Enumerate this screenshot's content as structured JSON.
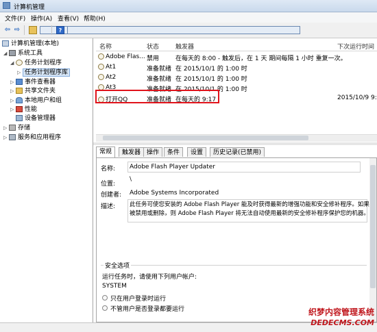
{
  "window": {
    "title": "计算机管理"
  },
  "menu": [
    "文件(F)",
    "操作(A)",
    "查看(V)",
    "帮助(H)"
  ],
  "toolbar": [
    "back-arrow-icon",
    "forward-arrow-icon",
    "up-folder-icon",
    "show-hide-tree-icon",
    "help-icon",
    "panel-icon"
  ],
  "tree": [
    {
      "label": "计算机管理(本地)"
    },
    {
      "label": "系统工具"
    },
    {
      "label": "任务计划程序"
    },
    {
      "label": "任务计划程序库"
    },
    {
      "label": "事件查看器"
    },
    {
      "label": "共享文件夹"
    },
    {
      "label": "本地用户和组"
    },
    {
      "label": "性能"
    },
    {
      "label": "设备管理器"
    },
    {
      "label": "存储"
    },
    {
      "label": "服务和应用程序"
    }
  ],
  "list": {
    "columns": [
      "名称",
      "状态",
      "触发器",
      "下次运行时间"
    ],
    "rows": [
      {
        "name": "Adobe Flas...",
        "status": "禁用",
        "trigger": "在每天的 8:00 - 触发后，在 1 天 期间每隔 1 小时 重复一次。",
        "next": ""
      },
      {
        "name": "At1",
        "status": "准备就绪",
        "trigger": "在 2015/10/1 的 1:00 时",
        "next": ""
      },
      {
        "name": "At2",
        "status": "准备就绪",
        "trigger": "在 2015/10/1 的 1:00 时",
        "next": ""
      },
      {
        "name": "At3",
        "status": "准备就绪",
        "trigger": "在 2015/10/1 的 1:00 时",
        "next": ""
      },
      {
        "name": "打开QQ",
        "status": "准备就绪",
        "trigger": "在每天的 9:17",
        "next": "2015/10/9 9:"
      }
    ]
  },
  "tabs": [
    "常规",
    "触发器",
    "操作",
    "条件",
    "设置",
    "历史记录(已禁用)"
  ],
  "detail": {
    "name_label": "名称:",
    "name_value": "Adobe Flash Player Updater",
    "location_label": "位置:",
    "location_value": "\\",
    "author_label": "创建者:",
    "author_value": "Adobe Systems Incorporated",
    "desc_label": "描述:",
    "desc_line1": "此任务可使您安装的 Adobe Flash Player 能及时获得最新的增强功能和安全修补程序。如果",
    "desc_line2": "被禁用或删除，则 Adobe Flash Player 将无法自动使用最新的安全修补程序保护您的机器。",
    "security_title": "安全选项",
    "run_as_label": "运行任务时，请使用下列用户帐户:",
    "run_as_value": "SYSTEM",
    "option1": "只在用户登录时运行",
    "option2": "不管用户是否登录都要运行"
  },
  "watermark": {
    "line1": "织梦内容管理系统",
    "line2": "DEDECMS.COM"
  }
}
